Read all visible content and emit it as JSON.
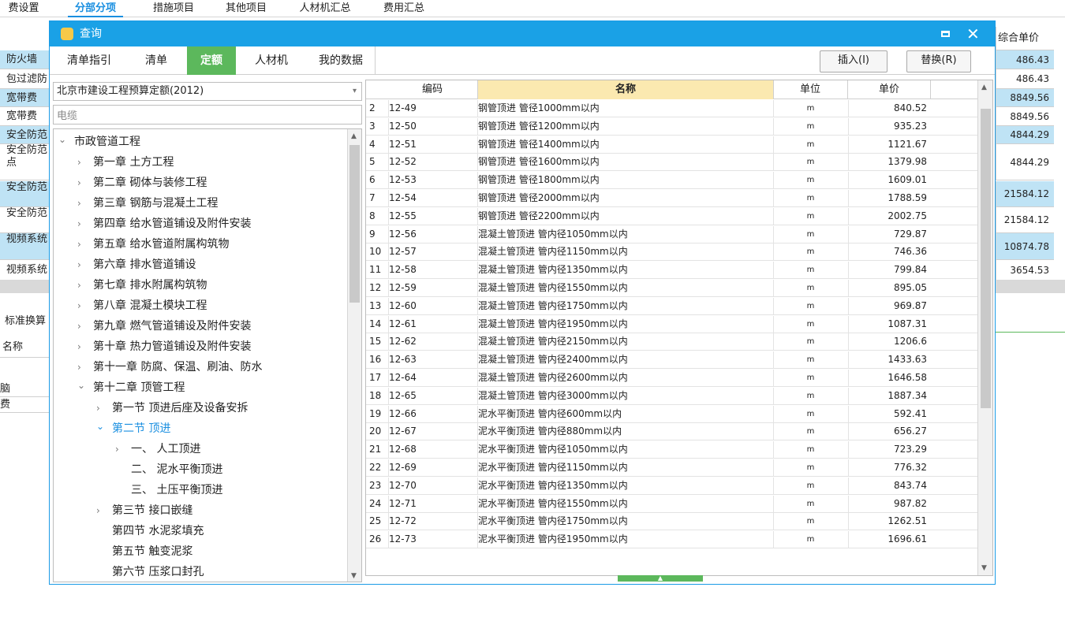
{
  "background": {
    "tabs": [
      "费设置",
      "分部分项",
      "措施项目",
      "其他项目",
      "人材机汇总",
      "费用汇总"
    ],
    "active_tab": "分部分项",
    "left_rows": [
      "防火墙",
      "包过滤防",
      "宽带费",
      "宽带费",
      "安全防范",
      "安全防范点",
      "安全防范",
      "安全防范",
      "视频系统",
      "视频系统"
    ],
    "right_header": "综合单价",
    "right_values": [
      "486.43",
      "486.43",
      "8849.56",
      "8849.56",
      "4844.29",
      "4844.29",
      "21584.12",
      "21584.12",
      "10874.78",
      "3654.53"
    ],
    "lower_tab": "标准换算",
    "lower_header": "名称",
    "lower_rows": [
      "脑",
      "费"
    ]
  },
  "dialog": {
    "title": "查询",
    "tabs": [
      "清单指引",
      "清单",
      "定额",
      "人材机",
      "我的数据"
    ],
    "active_tab": "定额",
    "insert_button": "插入(I)",
    "replace_button": "替换(R)",
    "library_select": "北京市建设工程预算定额(2012)",
    "search_value": "电缆",
    "tree": [
      {
        "label": "市政管道工程",
        "level": 0,
        "expanded": true
      },
      {
        "label": "第一章 土方工程",
        "level": 1,
        "expanded": false
      },
      {
        "label": "第二章 砌体与装修工程",
        "level": 1,
        "expanded": false
      },
      {
        "label": "第三章 钢筋与混凝土工程",
        "level": 1,
        "expanded": false
      },
      {
        "label": "第四章 给水管道铺设及附件安装",
        "level": 1,
        "expanded": false
      },
      {
        "label": "第五章 给水管道附属构筑物",
        "level": 1,
        "expanded": false
      },
      {
        "label": "第六章 排水管道铺设",
        "level": 1,
        "expanded": false
      },
      {
        "label": "第七章 排水附属构筑物",
        "level": 1,
        "expanded": false
      },
      {
        "label": "第八章 混凝土模块工程",
        "level": 1,
        "expanded": false
      },
      {
        "label": "第九章 燃气管道铺设及附件安装",
        "level": 1,
        "expanded": false
      },
      {
        "label": "第十章 热力管道铺设及附件安装",
        "level": 1,
        "expanded": false
      },
      {
        "label": "第十一章 防腐、保温、刷油、防水",
        "level": 1,
        "expanded": false
      },
      {
        "label": "第十二章 顶管工程",
        "level": 1,
        "expanded": true
      },
      {
        "label": "第一节 顶进后座及设备安拆",
        "level": 2,
        "expanded": false
      },
      {
        "label": "第二节 顶进",
        "level": 2,
        "expanded": true,
        "selected": true
      },
      {
        "label": "一、 人工顶进",
        "level": 3,
        "expanded": false
      },
      {
        "label": "二、 泥水平衡顶进",
        "level": 3,
        "leaf": true
      },
      {
        "label": "三、 土压平衡顶进",
        "level": 3,
        "leaf": true
      },
      {
        "label": "第三节 接口嵌缝",
        "level": 2,
        "expanded": false
      },
      {
        "label": "第四节 水泥浆填充",
        "level": 2,
        "leaf": true
      },
      {
        "label": "第五节 触变泥浆",
        "level": 2,
        "leaf": true
      },
      {
        "label": "第六节 压浆口封孔",
        "level": 2,
        "leaf": true
      }
    ],
    "grid_headers": {
      "code": "编码",
      "name": "名称",
      "unit": "单位",
      "price": "单价"
    },
    "grid_rows": [
      {
        "no": "2",
        "code": "12-49",
        "name": "钢管顶进 管径1000mm以内",
        "unit": "m",
        "price": "840.52"
      },
      {
        "no": "3",
        "code": "12-50",
        "name": "钢管顶进 管径1200mm以内",
        "unit": "m",
        "price": "935.23"
      },
      {
        "no": "4",
        "code": "12-51",
        "name": "钢管顶进 管径1400mm以内",
        "unit": "m",
        "price": "1121.67"
      },
      {
        "no": "5",
        "code": "12-52",
        "name": "钢管顶进 管径1600mm以内",
        "unit": "m",
        "price": "1379.98"
      },
      {
        "no": "6",
        "code": "12-53",
        "name": "钢管顶进 管径1800mm以内",
        "unit": "m",
        "price": "1609.01"
      },
      {
        "no": "7",
        "code": "12-54",
        "name": "钢管顶进 管径2000mm以内",
        "unit": "m",
        "price": "1788.59"
      },
      {
        "no": "8",
        "code": "12-55",
        "name": "钢管顶进 管径2200mm以内",
        "unit": "m",
        "price": "2002.75"
      },
      {
        "no": "9",
        "code": "12-56",
        "name": "混凝土管顶进 管内径1050mm以内",
        "unit": "m",
        "price": "729.87"
      },
      {
        "no": "10",
        "code": "12-57",
        "name": "混凝土管顶进 管内径1150mm以内",
        "unit": "m",
        "price": "746.36"
      },
      {
        "no": "11",
        "code": "12-58",
        "name": "混凝土管顶进 管内径1350mm以内",
        "unit": "m",
        "price": "799.84"
      },
      {
        "no": "12",
        "code": "12-59",
        "name": "混凝土管顶进 管内径1550mm以内",
        "unit": "m",
        "price": "895.05"
      },
      {
        "no": "13",
        "code": "12-60",
        "name": "混凝土管顶进 管内径1750mm以内",
        "unit": "m",
        "price": "969.87"
      },
      {
        "no": "14",
        "code": "12-61",
        "name": "混凝土管顶进 管内径1950mm以内",
        "unit": "m",
        "price": "1087.31"
      },
      {
        "no": "15",
        "code": "12-62",
        "name": "混凝土管顶进 管内径2150mm以内",
        "unit": "m",
        "price": "1206.6"
      },
      {
        "no": "16",
        "code": "12-63",
        "name": "混凝土管顶进 管内径2400mm以内",
        "unit": "m",
        "price": "1433.63"
      },
      {
        "no": "17",
        "code": "12-64",
        "name": "混凝土管顶进 管内径2600mm以内",
        "unit": "m",
        "price": "1646.58"
      },
      {
        "no": "18",
        "code": "12-65",
        "name": "混凝土管顶进 管内径3000mm以内",
        "unit": "m",
        "price": "1887.34"
      },
      {
        "no": "19",
        "code": "12-66",
        "name": "泥水平衡顶进 管内径600mm以内",
        "unit": "m",
        "price": "592.41"
      },
      {
        "no": "20",
        "code": "12-67",
        "name": "泥水平衡顶进 管内径880mm以内",
        "unit": "m",
        "price": "656.27"
      },
      {
        "no": "21",
        "code": "12-68",
        "name": "泥水平衡顶进 管内径1050mm以内",
        "unit": "m",
        "price": "723.29"
      },
      {
        "no": "22",
        "code": "12-69",
        "name": "泥水平衡顶进 管内径1150mm以内",
        "unit": "m",
        "price": "776.32"
      },
      {
        "no": "23",
        "code": "12-70",
        "name": "泥水平衡顶进 管内径1350mm以内",
        "unit": "m",
        "price": "843.74"
      },
      {
        "no": "24",
        "code": "12-71",
        "name": "泥水平衡顶进 管内径1550mm以内",
        "unit": "m",
        "price": "987.82"
      },
      {
        "no": "25",
        "code": "12-72",
        "name": "泥水平衡顶进 管内径1750mm以内",
        "unit": "m",
        "price": "1262.51"
      },
      {
        "no": "26",
        "code": "12-73",
        "name": "泥水平衡顶进 管内径1950mm以内",
        "unit": "m",
        "price": "1696.61"
      }
    ],
    "colors": {
      "title_bar": "#1aa1e6",
      "active_tab": "#5cb85c",
      "selected_tree": "#1a8fe0",
      "name_header": "#fbe9b0",
      "selected_row": "#bfe3f5"
    }
  }
}
